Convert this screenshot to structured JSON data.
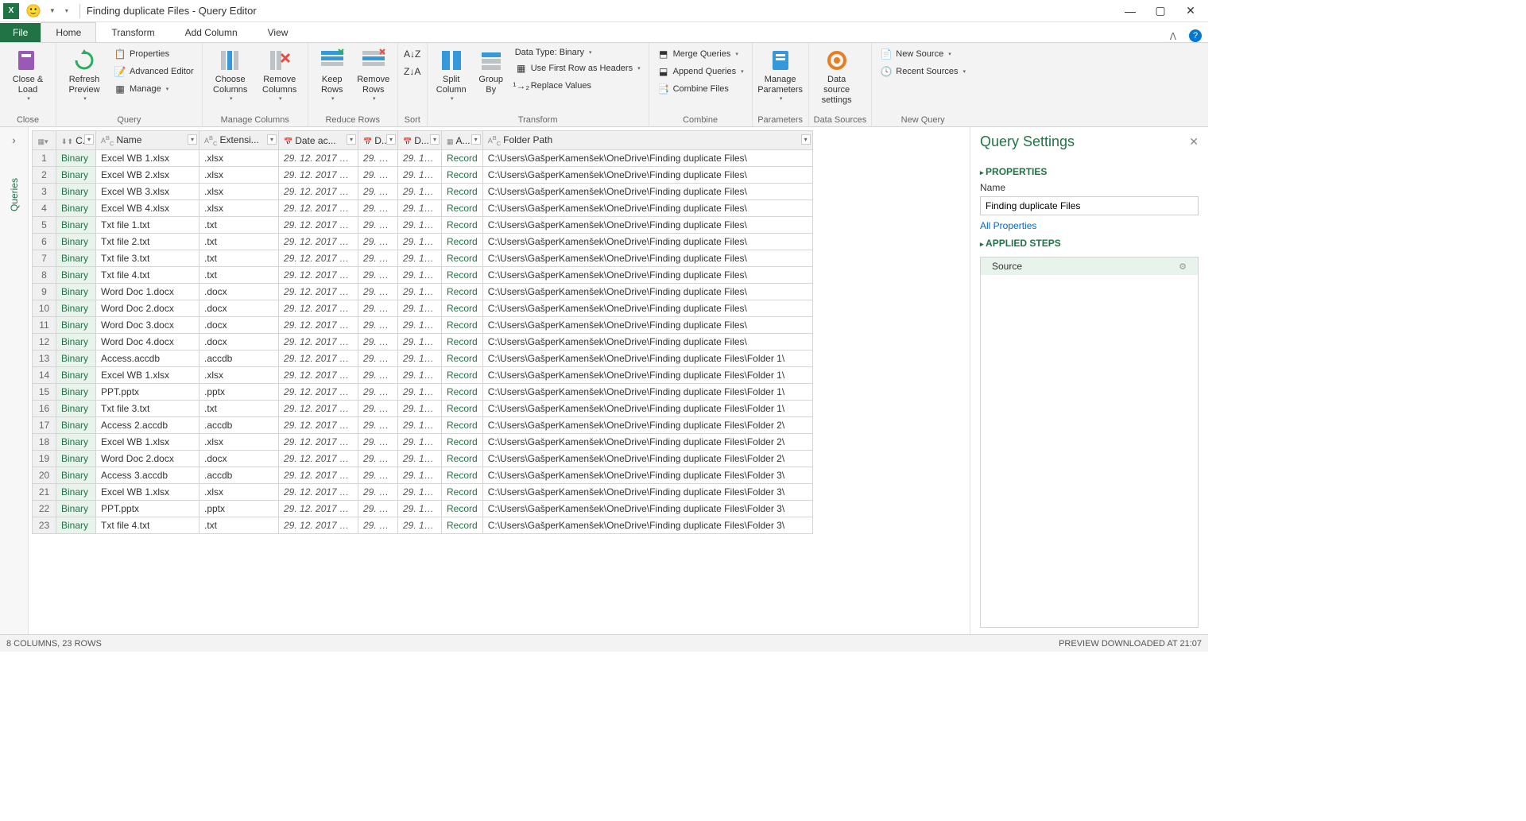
{
  "title": "Finding duplicate Files - Query Editor",
  "tabs": {
    "file": "File",
    "home": "Home",
    "transform": "Transform",
    "addcol": "Add Column",
    "view": "View"
  },
  "ribbon": {
    "close": {
      "label": "Close &\nLoad",
      "group": "Close"
    },
    "query": {
      "refresh": "Refresh\nPreview",
      "properties": "Properties",
      "advanced": "Advanced Editor",
      "manage": "Manage",
      "group": "Query"
    },
    "managecols": {
      "choose": "Choose\nColumns",
      "remove": "Remove\nColumns",
      "group": "Manage Columns"
    },
    "reducerows": {
      "keep": "Keep\nRows",
      "remove": "Remove\nRows",
      "group": "Reduce Rows"
    },
    "sort": {
      "group": "Sort"
    },
    "transform": {
      "split": "Split\nColumn",
      "groupby": "Group\nBy",
      "datatype": "Data Type: Binary",
      "firstrow": "Use First Row as Headers",
      "replace": "Replace Values",
      "group": "Transform"
    },
    "combine": {
      "merge": "Merge Queries",
      "append": "Append Queries",
      "files": "Combine Files",
      "group": "Combine"
    },
    "params": {
      "label": "Manage\nParameters",
      "group": "Parameters"
    },
    "datasrc": {
      "label": "Data source\nsettings",
      "group": "Data Sources"
    },
    "newquery": {
      "new": "New Source",
      "recent": "Recent Sources",
      "group": "New Query"
    }
  },
  "nav": {
    "queries": "Queries"
  },
  "columns": [
    "",
    "C...",
    "Name",
    "Extensi...",
    "Date ac...",
    "D...",
    "D...",
    "A...",
    "Folder Path"
  ],
  "rows": [
    {
      "n": 1,
      "c": "Binary",
      "name": "Excel WB 1.xlsx",
      "ext": ".xlsx",
      "d1": "29. 12. 2017 20...",
      "d2": "29. 12....",
      "d3": "29. 12. ...",
      "a": "Record",
      "fp": "C:\\Users\\GašperKamenšek\\OneDrive\\Finding duplicate Files\\"
    },
    {
      "n": 2,
      "c": "Binary",
      "name": "Excel WB 2.xlsx",
      "ext": ".xlsx",
      "d1": "29. 12. 2017 20...",
      "d2": "29. 12....",
      "d3": "29. 12. ...",
      "a": "Record",
      "fp": "C:\\Users\\GašperKamenšek\\OneDrive\\Finding duplicate Files\\"
    },
    {
      "n": 3,
      "c": "Binary",
      "name": "Excel WB 3.xlsx",
      "ext": ".xlsx",
      "d1": "29. 12. 2017 20...",
      "d2": "29. 12....",
      "d3": "29. 12. ...",
      "a": "Record",
      "fp": "C:\\Users\\GašperKamenšek\\OneDrive\\Finding duplicate Files\\"
    },
    {
      "n": 4,
      "c": "Binary",
      "name": "Excel WB 4.xlsx",
      "ext": ".xlsx",
      "d1": "29. 12. 2017 20...",
      "d2": "29. 12....",
      "d3": "29. 12. ...",
      "a": "Record",
      "fp": "C:\\Users\\GašperKamenšek\\OneDrive\\Finding duplicate Files\\"
    },
    {
      "n": 5,
      "c": "Binary",
      "name": "Txt file 1.txt",
      "ext": ".txt",
      "d1": "29. 12. 2017 20...",
      "d2": "29. 12....",
      "d3": "29. 12. ...",
      "a": "Record",
      "fp": "C:\\Users\\GašperKamenšek\\OneDrive\\Finding duplicate Files\\"
    },
    {
      "n": 6,
      "c": "Binary",
      "name": "Txt file 2.txt",
      "ext": ".txt",
      "d1": "29. 12. 2017 20...",
      "d2": "29. 12....",
      "d3": "29. 12. ...",
      "a": "Record",
      "fp": "C:\\Users\\GašperKamenšek\\OneDrive\\Finding duplicate Files\\"
    },
    {
      "n": 7,
      "c": "Binary",
      "name": "Txt file 3.txt",
      "ext": ".txt",
      "d1": "29. 12. 2017 20...",
      "d2": "29. 12....",
      "d3": "29. 12. ...",
      "a": "Record",
      "fp": "C:\\Users\\GašperKamenšek\\OneDrive\\Finding duplicate Files\\"
    },
    {
      "n": 8,
      "c": "Binary",
      "name": "Txt file 4.txt",
      "ext": ".txt",
      "d1": "29. 12. 2017 20...",
      "d2": "29. 12....",
      "d3": "29. 12. ...",
      "a": "Record",
      "fp": "C:\\Users\\GašperKamenšek\\OneDrive\\Finding duplicate Files\\"
    },
    {
      "n": 9,
      "c": "Binary",
      "name": "Word Doc 1.docx",
      "ext": ".docx",
      "d1": "29. 12. 2017 20...",
      "d2": "29. 12....",
      "d3": "29. 12. ...",
      "a": "Record",
      "fp": "C:\\Users\\GašperKamenšek\\OneDrive\\Finding duplicate Files\\"
    },
    {
      "n": 10,
      "c": "Binary",
      "name": "Word Doc 2.docx",
      "ext": ".docx",
      "d1": "29. 12. 2017 20...",
      "d2": "29. 12....",
      "d3": "29. 12. ...",
      "a": "Record",
      "fp": "C:\\Users\\GašperKamenšek\\OneDrive\\Finding duplicate Files\\"
    },
    {
      "n": 11,
      "c": "Binary",
      "name": "Word Doc 3.docx",
      "ext": ".docx",
      "d1": "29. 12. 2017 20...",
      "d2": "29. 12....",
      "d3": "29. 12. ...",
      "a": "Record",
      "fp": "C:\\Users\\GašperKamenšek\\OneDrive\\Finding duplicate Files\\"
    },
    {
      "n": 12,
      "c": "Binary",
      "name": "Word Doc 4.docx",
      "ext": ".docx",
      "d1": "29. 12. 2017 20...",
      "d2": "29. 12....",
      "d3": "29. 12. ...",
      "a": "Record",
      "fp": "C:\\Users\\GašperKamenšek\\OneDrive\\Finding duplicate Files\\"
    },
    {
      "n": 13,
      "c": "Binary",
      "name": "Access.accdb",
      "ext": ".accdb",
      "d1": "29. 12. 2017 20...",
      "d2": "29. 12....",
      "d3": "29. 12. ...",
      "a": "Record",
      "fp": "C:\\Users\\GašperKamenšek\\OneDrive\\Finding duplicate Files\\Folder 1\\"
    },
    {
      "n": 14,
      "c": "Binary",
      "name": "Excel WB 1.xlsx",
      "ext": ".xlsx",
      "d1": "29. 12. 2017 20...",
      "d2": "29. 12....",
      "d3": "29. 12. ...",
      "a": "Record",
      "fp": "C:\\Users\\GašperKamenšek\\OneDrive\\Finding duplicate Files\\Folder 1\\"
    },
    {
      "n": 15,
      "c": "Binary",
      "name": "PPT.pptx",
      "ext": ".pptx",
      "d1": "29. 12. 2017 20...",
      "d2": "29. 12....",
      "d3": "29. 12. ...",
      "a": "Record",
      "fp": "C:\\Users\\GašperKamenšek\\OneDrive\\Finding duplicate Files\\Folder 1\\"
    },
    {
      "n": 16,
      "c": "Binary",
      "name": "Txt file 3.txt",
      "ext": ".txt",
      "d1": "29. 12. 2017 20...",
      "d2": "29. 12....",
      "d3": "29. 12. ...",
      "a": "Record",
      "fp": "C:\\Users\\GašperKamenšek\\OneDrive\\Finding duplicate Files\\Folder 1\\"
    },
    {
      "n": 17,
      "c": "Binary",
      "name": "Access 2.accdb",
      "ext": ".accdb",
      "d1": "29. 12. 2017 20...",
      "d2": "29. 12....",
      "d3": "29. 12. ...",
      "a": "Record",
      "fp": "C:\\Users\\GašperKamenšek\\OneDrive\\Finding duplicate Files\\Folder 2\\"
    },
    {
      "n": 18,
      "c": "Binary",
      "name": "Excel WB 1.xlsx",
      "ext": ".xlsx",
      "d1": "29. 12. 2017 20...",
      "d2": "29. 12....",
      "d3": "29. 12. ...",
      "a": "Record",
      "fp": "C:\\Users\\GašperKamenšek\\OneDrive\\Finding duplicate Files\\Folder 2\\"
    },
    {
      "n": 19,
      "c": "Binary",
      "name": "Word Doc 2.docx",
      "ext": ".docx",
      "d1": "29. 12. 2017 20...",
      "d2": "29. 12....",
      "d3": "29. 12. ...",
      "a": "Record",
      "fp": "C:\\Users\\GašperKamenšek\\OneDrive\\Finding duplicate Files\\Folder 2\\"
    },
    {
      "n": 20,
      "c": "Binary",
      "name": "Access 3.accdb",
      "ext": ".accdb",
      "d1": "29. 12. 2017 20...",
      "d2": "29. 12....",
      "d3": "29. 12. ...",
      "a": "Record",
      "fp": "C:\\Users\\GašperKamenšek\\OneDrive\\Finding duplicate Files\\Folder 3\\"
    },
    {
      "n": 21,
      "c": "Binary",
      "name": "Excel WB 1.xlsx",
      "ext": ".xlsx",
      "d1": "29. 12. 2017 20...",
      "d2": "29. 12....",
      "d3": "29. 12. ...",
      "a": "Record",
      "fp": "C:\\Users\\GašperKamenšek\\OneDrive\\Finding duplicate Files\\Folder 3\\"
    },
    {
      "n": 22,
      "c": "Binary",
      "name": "PPT.pptx",
      "ext": ".pptx",
      "d1": "29. 12. 2017 20...",
      "d2": "29. 12....",
      "d3": "29. 12. ...",
      "a": "Record",
      "fp": "C:\\Users\\GašperKamenšek\\OneDrive\\Finding duplicate Files\\Folder 3\\"
    },
    {
      "n": 23,
      "c": "Binary",
      "name": "Txt file 4.txt",
      "ext": ".txt",
      "d1": "29. 12. 2017 20...",
      "d2": "29. 12....",
      "d3": "29. 12. ...",
      "a": "Record",
      "fp": "C:\\Users\\GašperKamenšek\\OneDrive\\Finding duplicate Files\\Folder 3\\"
    }
  ],
  "settings": {
    "title": "Query Settings",
    "properties": "PROPERTIES",
    "nameLabel": "Name",
    "nameValue": "Finding duplicate Files",
    "allprops": "All Properties",
    "applied": "APPLIED STEPS",
    "step1": "Source"
  },
  "status": {
    "left": "8 COLUMNS, 23 ROWS",
    "right": "PREVIEW DOWNLOADED AT 21:07"
  }
}
